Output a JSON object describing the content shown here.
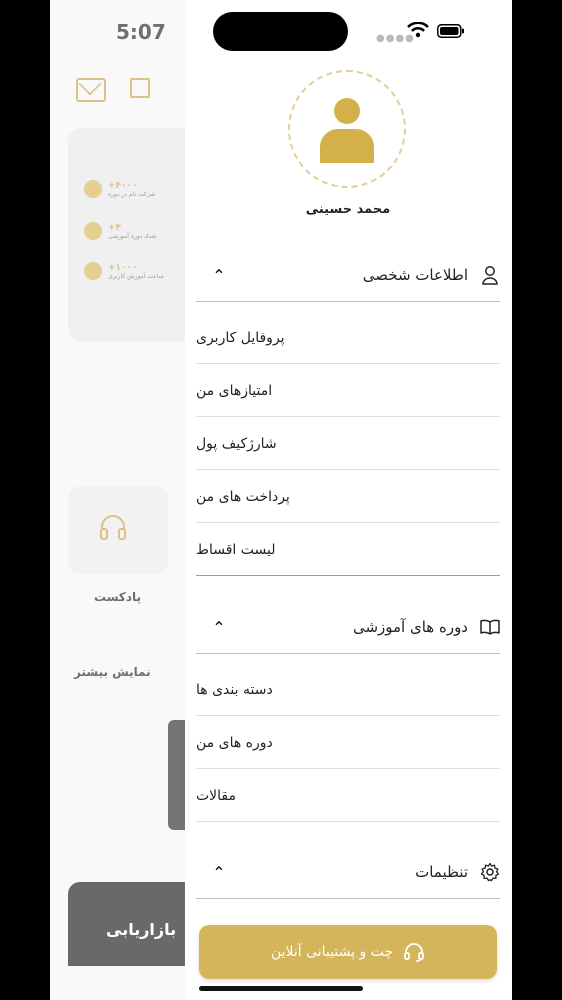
{
  "status_bar": {
    "time": "5:07"
  },
  "background": {
    "stats": [
      {
        "value": "+۴۰۰۰",
        "label": "شرکت نام در دوره"
      },
      {
        "value": "+۴",
        "label": "تعداد دوره آموزشی"
      },
      {
        "value": "+۱۰۰۰",
        "label": "ساعت آموزش کاربری"
      }
    ],
    "podcast_label": "پادکست",
    "show_more": "نمایش بیشتر",
    "banner_text": "بازاریابی"
  },
  "drawer": {
    "user_name": "محمد حسینی",
    "sections": [
      {
        "title": "اطلاعات شخصی",
        "icon": "person-icon",
        "items": [
          "پروفایل کاربری",
          "امتیازهای من",
          "شارژکیف پول",
          "پرداخت های من",
          "لیست اقساط"
        ]
      },
      {
        "title": "دوره های آموزشی",
        "icon": "book-icon",
        "items": [
          "دسته بندی ها",
          "دوره های من",
          "مقالات"
        ]
      },
      {
        "title": "تنظیمات",
        "icon": "gear-icon",
        "items": []
      }
    ],
    "chat_button": "چت و پشتیبانی آنلاین"
  },
  "colors": {
    "accent": "#d4b55b",
    "avatar": "#d4b04b"
  }
}
